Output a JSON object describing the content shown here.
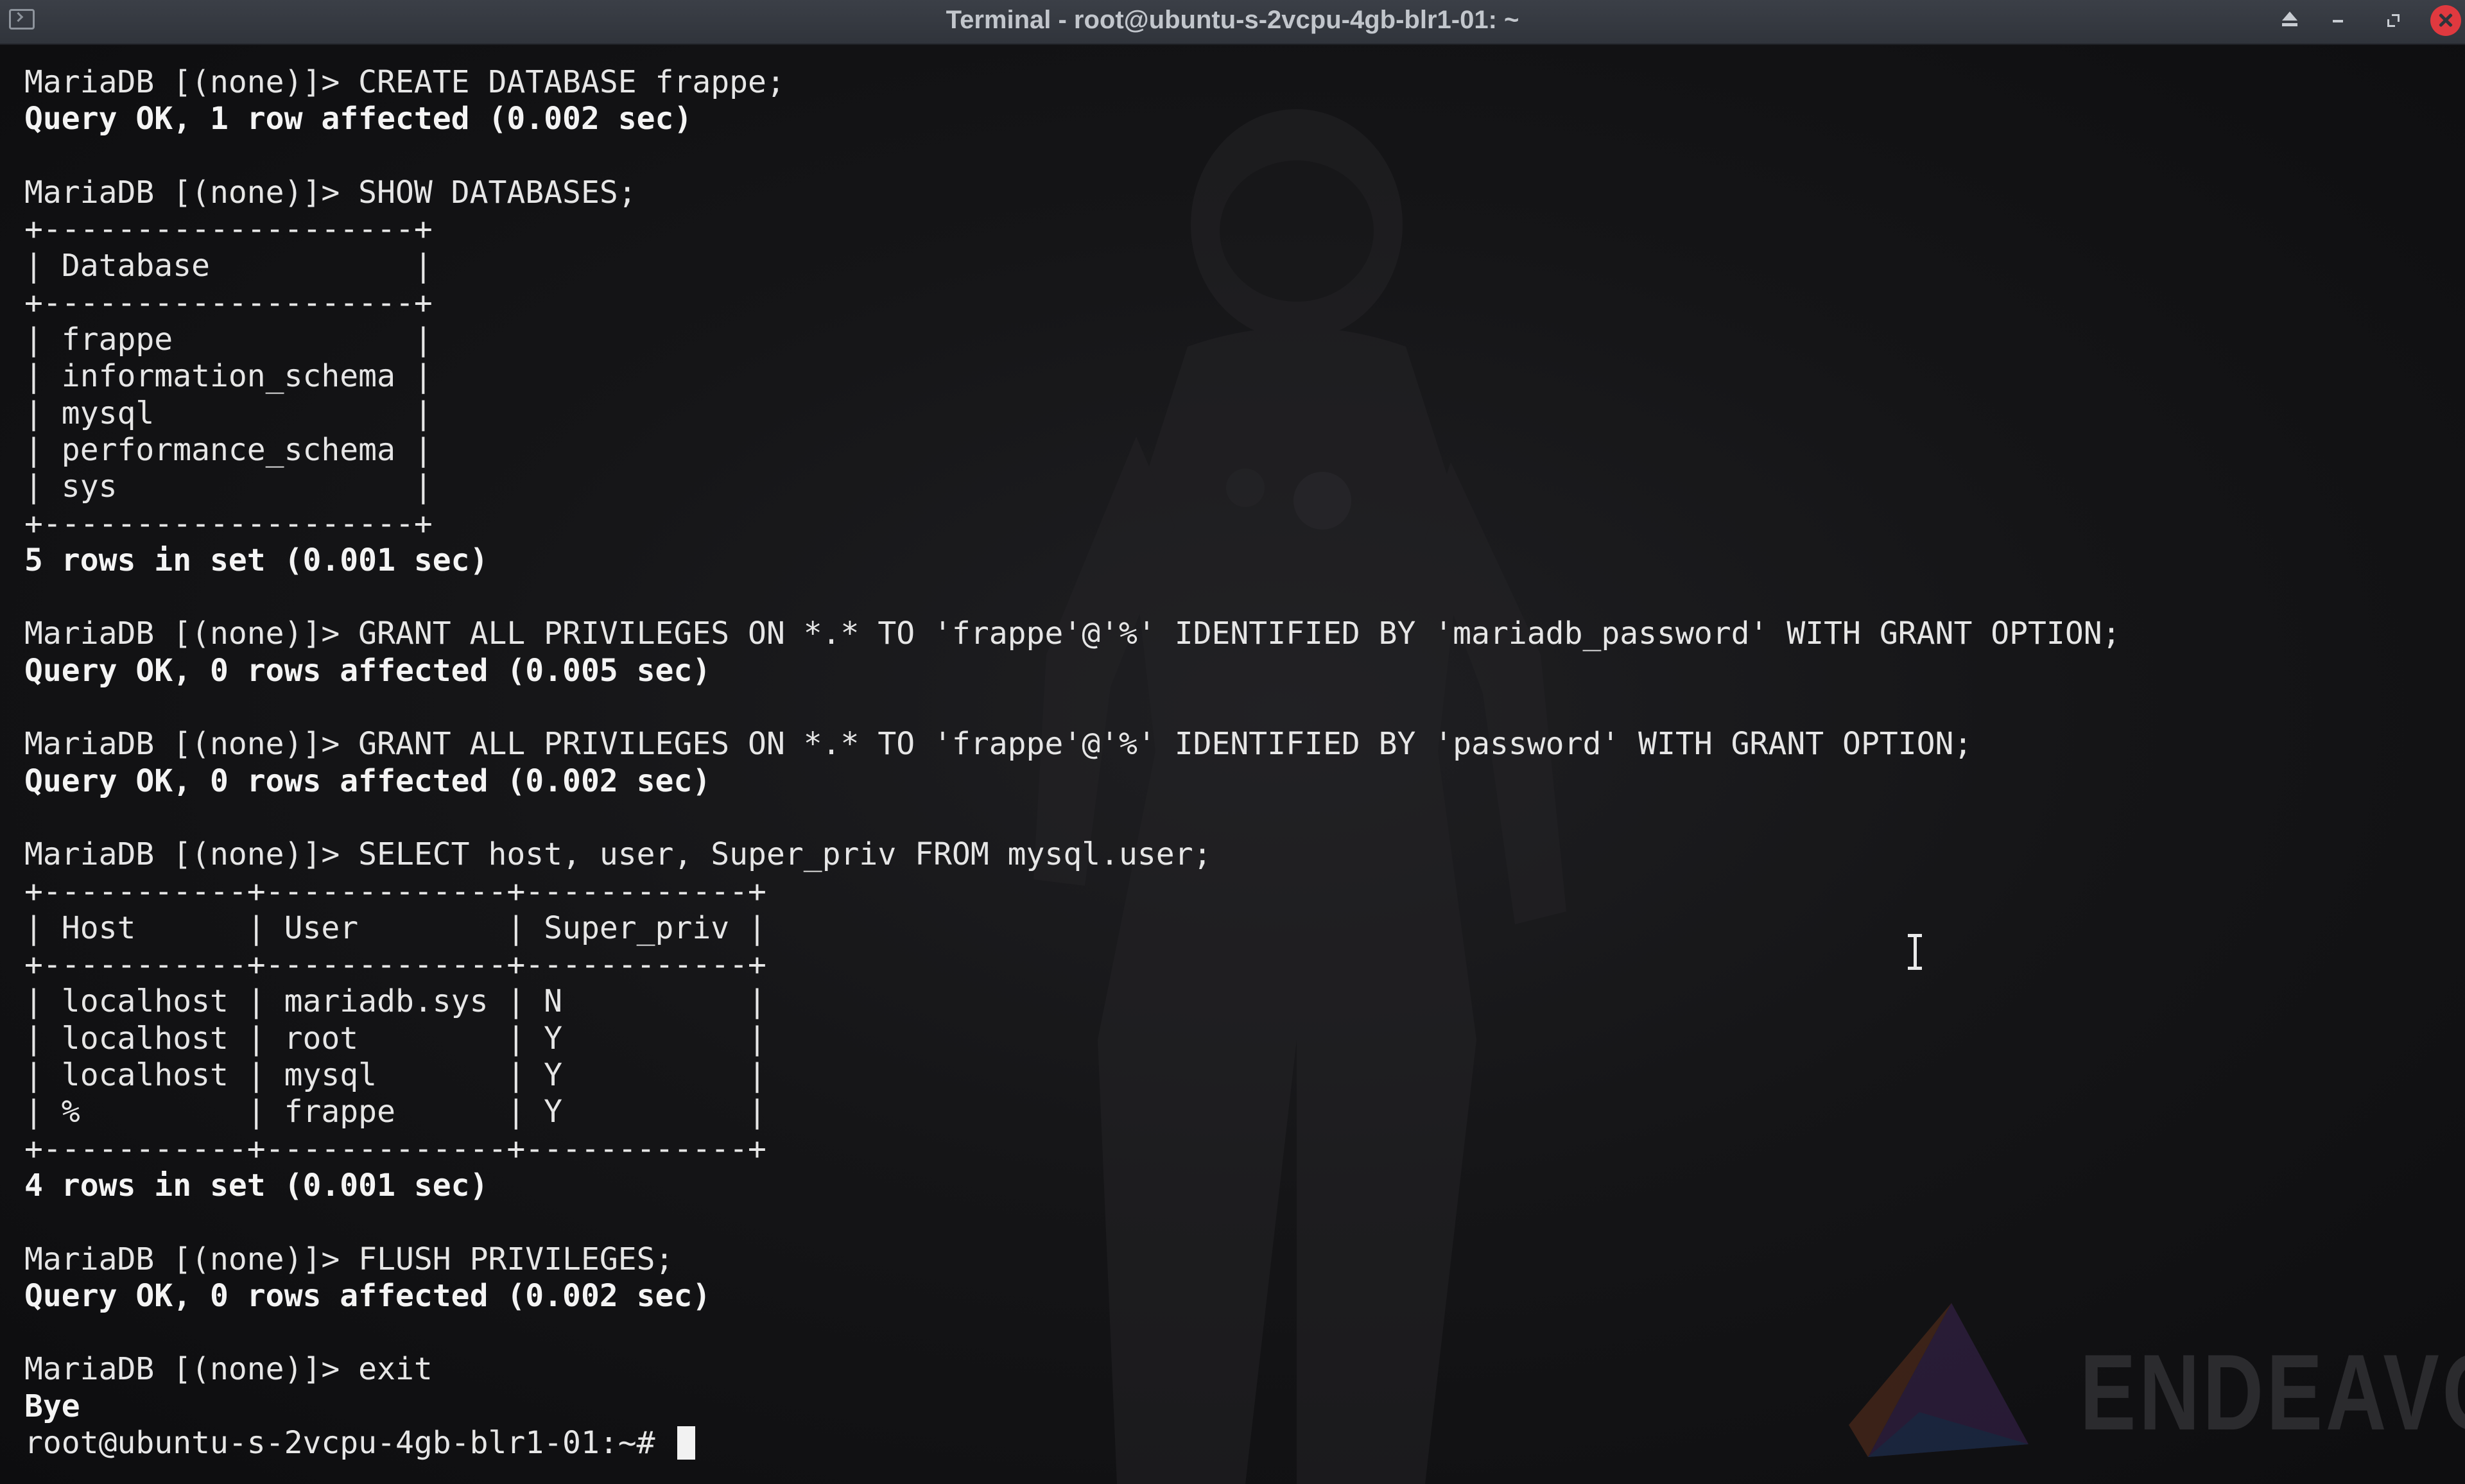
{
  "window": {
    "title": "Terminal - root@ubuntu-s-2vcpu-4gb-blr1-01: ~",
    "icons": [
      "terminal-app-icon",
      "keep-above-icon",
      "minimize-icon",
      "maximize-icon",
      "close-icon"
    ],
    "colors": {
      "titlebar": "#353940",
      "close_button": "#e0393f",
      "background": "#141416",
      "text": "#e6e6e6"
    }
  },
  "wallpaper": {
    "watermark_text": "ENDEAVOURO"
  },
  "terminal": {
    "lines": [
      "MariaDB [(none)]> CREATE DATABASE frappe;",
      "Query OK, 1 row affected (0.002 sec)",
      "",
      "MariaDB [(none)]> SHOW DATABASES;",
      "+--------------------+",
      "| Database           |",
      "+--------------------+",
      "| frappe             |",
      "| information_schema |",
      "| mysql              |",
      "| performance_schema |",
      "| sys                |",
      "+--------------------+",
      "5 rows in set (0.001 sec)",
      "",
      "MariaDB [(none)]> GRANT ALL PRIVILEGES ON *.* TO 'frappe'@'%' IDENTIFIED BY 'mariadb_password' WITH GRANT OPTION;",
      "Query OK, 0 rows affected (0.005 sec)",
      "",
      "MariaDB [(none)]> GRANT ALL PRIVILEGES ON *.* TO 'frappe'@'%' IDENTIFIED BY 'password' WITH GRANT OPTION;",
      "Query OK, 0 rows affected (0.002 sec)",
      "",
      "MariaDB [(none)]> SELECT host, user, Super_priv FROM mysql.user;",
      "+-----------+-------------+------------+",
      "| Host      | User        | Super_priv |",
      "+-----------+-------------+------------+",
      "| localhost | mariadb.sys | N          |",
      "| localhost | root        | Y          |",
      "| localhost | mysql       | Y          |",
      "| %         | frappe      | Y          |",
      "+-----------+-------------+------------+",
      "4 rows in set (0.001 sec)",
      "",
      "MariaDB [(none)]> FLUSH PRIVILEGES;",
      "Query OK, 0 rows affected (0.002 sec)",
      "",
      "MariaDB [(none)]> exit",
      "Bye"
    ],
    "bold_lines": [
      1,
      13,
      16,
      19,
      30,
      33,
      36
    ],
    "prompt": "root@ubuntu-s-2vcpu-4gb-blr1-01:~# ",
    "cursor_icon": "ibeam-cursor-icon"
  }
}
